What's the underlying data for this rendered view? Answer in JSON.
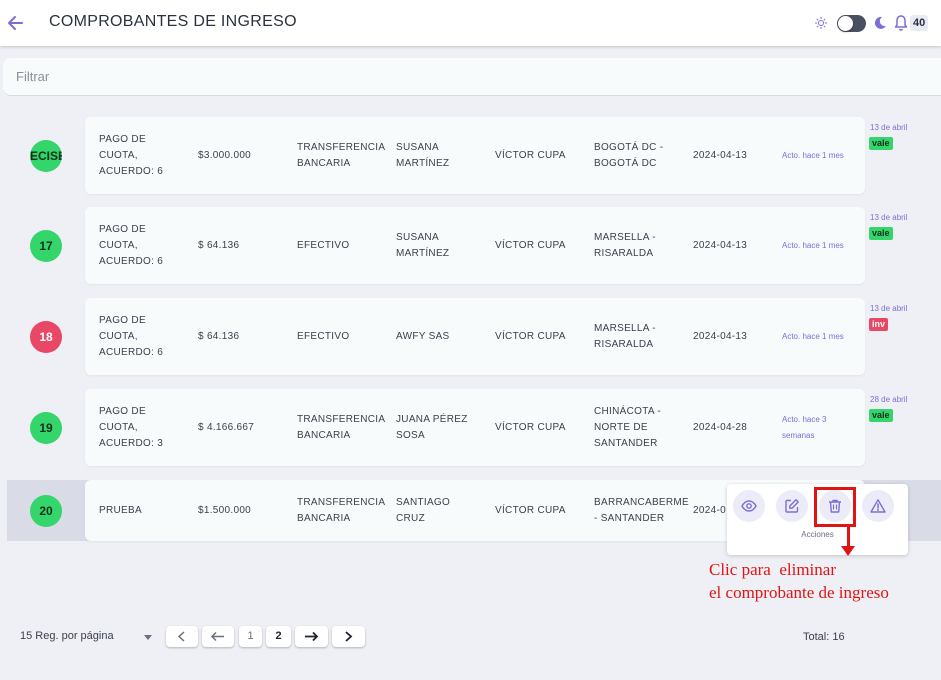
{
  "header": {
    "title": "COMPROBANTES DE INGRESO",
    "notification_count": "40",
    "theme_toggle": "light"
  },
  "filter": {
    "placeholder": "Filtrar",
    "value": ""
  },
  "rows": [
    {
      "id": "ECISE",
      "status_color": "green",
      "concept": [
        "PAGO DE",
        "CUOTA,",
        "ACUERDO: 6"
      ],
      "amount": "$3.000.000",
      "method": [
        "TRANSFERENCIA",
        "BANCARIA"
      ],
      "payer": [
        "SUSANA",
        "MARTÍNEZ"
      ],
      "user": "VÍCTOR CUPA",
      "city": [
        "BOGOTÁ DC -",
        "BOGOTÁ DC"
      ],
      "date": "2024-04-13",
      "updated": [
        "Acto. hace 1 mes"
      ],
      "side_date": "13 de abril",
      "tag": "vale",
      "tag_color": "green"
    },
    {
      "id": "17",
      "status_color": "green",
      "concept": [
        "PAGO DE",
        "CUOTA,",
        "ACUERDO: 6"
      ],
      "amount": "$ 64.136",
      "method": [
        "EFECTIVO"
      ],
      "payer": [
        "SUSANA",
        "MARTÍNEZ"
      ],
      "user": "VÍCTOR CUPA",
      "city": [
        "MARSELLA -",
        "RISARALDA"
      ],
      "date": "2024-04-13",
      "updated": [
        "Acto. hace 1 mes"
      ],
      "side_date": "13 de abril",
      "tag": "vale",
      "tag_color": "green"
    },
    {
      "id": "18",
      "status_color": "red",
      "concept": [
        "PAGO DE",
        "CUOTA,",
        "ACUERDO: 6"
      ],
      "amount": "$ 64.136",
      "method": [
        "EFECTIVO"
      ],
      "payer": [
        "AWFY SAS"
      ],
      "user": "VÍCTOR CUPA",
      "city": [
        "MARSELLA -",
        "RISARALDA"
      ],
      "date": "2024-04-13",
      "updated": [
        "Acto. hace 1 mes"
      ],
      "side_date": "13 de abril",
      "tag": "inv",
      "tag_color": "red"
    },
    {
      "id": "19",
      "status_color": "green",
      "concept": [
        "PAGO DE",
        "CUOTA,",
        "ACUERDO: 3"
      ],
      "amount": "$ 4.166.667",
      "method": [
        "TRANSFERENCIA",
        "BANCARIA"
      ],
      "payer": [
        "JUANA PÉREZ",
        "SOSA"
      ],
      "user": "VÍCTOR CUPA",
      "city": [
        "CHINÁCOTA -",
        "NORTE DE",
        "SANTANDER"
      ],
      "date": "2024-04-28",
      "updated": [
        "Acto. hace 3",
        "semanas"
      ],
      "side_date": "28 de abril",
      "tag": "vale",
      "tag_color": "green"
    },
    {
      "id": "20",
      "status_color": "green",
      "concept": [
        "PRUEBA"
      ],
      "amount": "$1.500.000",
      "method": [
        "TRANSFERENCIA",
        "BANCARIA"
      ],
      "payer": [
        "SANTIAGO",
        "CRUZ"
      ],
      "user": "VÍCTOR CUPA",
      "city": [
        "BARRANCABERME",
        "- SANTANDER"
      ],
      "date": "2024-0",
      "updated": [],
      "side_date": "",
      "tag": "",
      "tag_color": ""
    }
  ],
  "actions": {
    "label": "Acciones",
    "buttons": [
      "view",
      "edit",
      "delete",
      "report"
    ],
    "icons": [
      "eye-icon",
      "edit-icon",
      "trash-icon",
      "warning-icon"
    ]
  },
  "annotation": {
    "text": "Clic para  eliminar\nel comprobante de ingreso",
    "color": "#e11414"
  },
  "pagination": {
    "per_page_label": "15 Reg. por página",
    "pages": [
      "1",
      "2"
    ],
    "current_page": "2",
    "total_label": "Total: 16"
  },
  "colors": {
    "accent": "#7b6fd6",
    "green": "#34d56a",
    "red": "#e94766",
    "highlight": "#e11414"
  }
}
